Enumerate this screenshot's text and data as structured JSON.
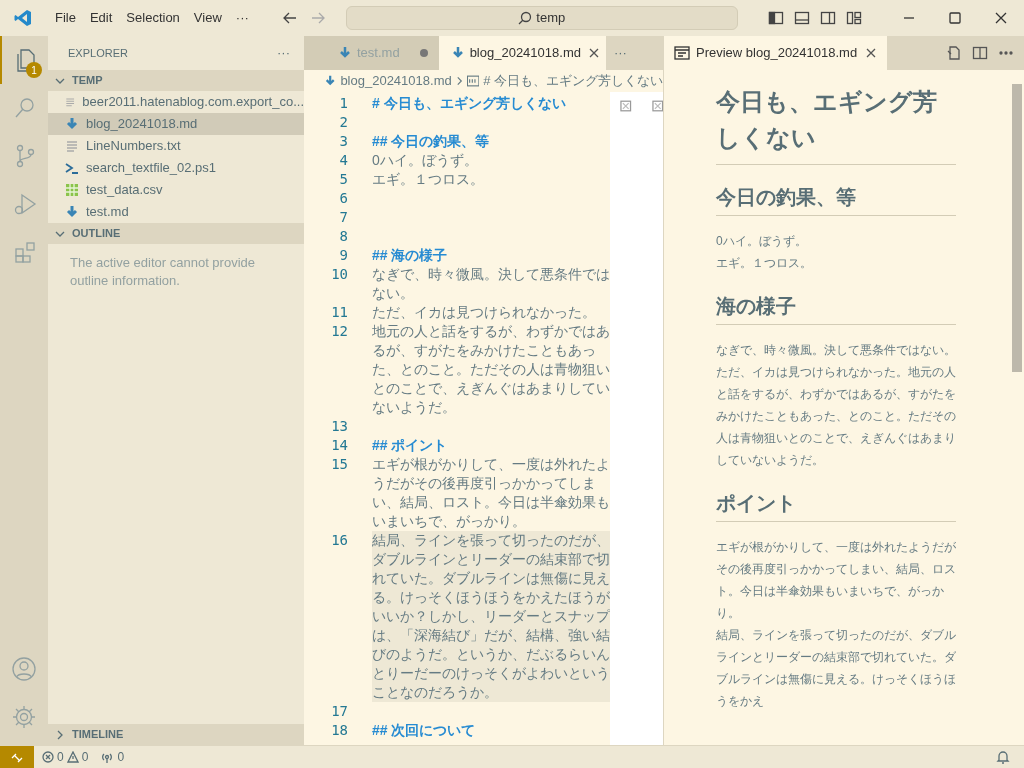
{
  "title_bar": {
    "menu": [
      "File",
      "Edit",
      "Selection",
      "View",
      "···"
    ],
    "search": "temp"
  },
  "activity_bar": {
    "items": [
      {
        "kind": "explorer",
        "selected": true,
        "badge": "1"
      },
      {
        "kind": "search",
        "selected": false
      },
      {
        "kind": "source-control",
        "selected": false
      },
      {
        "kind": "run",
        "selected": false
      },
      {
        "kind": "extensions",
        "selected": false
      }
    ],
    "bottom": [
      {
        "kind": "account"
      },
      {
        "kind": "settings"
      }
    ]
  },
  "sidebar": {
    "title": "EXPLORER",
    "more": "···",
    "sections": [
      {
        "title": "TEMP",
        "expanded": true,
        "files": [
          {
            "name": "beer2011.hatenablog.com.export_co...",
            "kind": "text",
            "selected": false
          },
          {
            "name": "blog_20241018.md",
            "kind": "markdown",
            "selected": true
          },
          {
            "name": "LineNumbers.txt",
            "kind": "text",
            "selected": false
          },
          {
            "name": "search_textfile_02.ps1",
            "kind": "powershell",
            "selected": false
          },
          {
            "name": "test_data.csv",
            "kind": "csv",
            "selected": false
          },
          {
            "name": "test.md",
            "kind": "markdown",
            "selected": false
          }
        ]
      },
      {
        "title": "OUTLINE",
        "expanded": true,
        "message": "The active editor cannot provide outline information."
      },
      {
        "title": "TIMELINE",
        "expanded": false
      }
    ]
  },
  "editor": {
    "tabs": [
      {
        "label": "test.md",
        "selected": false,
        "dirty": true
      },
      {
        "label": "blog_20241018.md",
        "selected": true,
        "dirty": false
      }
    ],
    "more": "···",
    "breadcrumb": [
      "blog_20241018.md",
      "# 今日も、エギング芳しくない"
    ],
    "lines": [
      {
        "number": "1",
        "kind": "heading",
        "text": "# 今日も、エギング芳しくない",
        "current": false
      },
      {
        "number": "2",
        "kind": "blank",
        "current": false
      },
      {
        "number": "3",
        "kind": "heading",
        "text": "## 今日の釣果、等",
        "current": false
      },
      {
        "number": "4",
        "kind": "text",
        "text": "0ハイ。ぼうず。",
        "current": false
      },
      {
        "number": "5",
        "kind": "text",
        "text": "エギ。１つロス。",
        "current": false
      },
      {
        "number": "6",
        "kind": "blank",
        "current": false
      },
      {
        "number": "7",
        "kind": "blank",
        "current": false
      },
      {
        "number": "8",
        "kind": "blank",
        "current": false
      },
      {
        "number": "9",
        "kind": "heading",
        "text": "## 海の様子",
        "current": false
      },
      {
        "number": "10",
        "kind": "text",
        "text": "なぎで、時々微風。決して悪条件ではない。",
        "current": false
      },
      {
        "number": "11",
        "kind": "text",
        "text": "ただ、イカは見つけられなかった。",
        "current": false
      },
      {
        "number": "12",
        "kind": "text",
        "text": "地元の人と話をするが、わずかではあるが、すがたをみかけたこともあった、とのこと。ただその人は青物狙いとのことで、えぎんぐはあまりしていないようだ。",
        "current": false
      },
      {
        "number": "13",
        "kind": "blank",
        "current": false
      },
      {
        "number": "14",
        "kind": "heading",
        "text": "## ポイント",
        "current": false
      },
      {
        "number": "15",
        "kind": "text",
        "text": "エギが根がかりして、一度は外れたようだがその後再度引っかかってしまい、結局、ロスト。今日は半傘効果もいまいちで、がっかり。",
        "current": false
      },
      {
        "number": "16",
        "kind": "text",
        "text": "結局、ラインを張って切ったのだが、ダブルラインとリーダーの結束部で切れていた。ダブルラインは無傷に見える。けっそくほうほうをかえたほうがいいか？しかし、リーダーとスナップは、「深海結び」だが、結構、強い結びのようだ。というか、だぶるらいんとりーだーのけっそくがよわいということなのだろうか。",
        "current": true
      },
      {
        "number": "17",
        "kind": "blank",
        "current": false
      },
      {
        "number": "18",
        "kind": "heading",
        "text": "## 次回について",
        "current": false
      }
    ]
  },
  "preview": {
    "tab": "Preview blog_20241018.md",
    "blocks": [
      {
        "kind": "h1",
        "text": "今日も、エギング芳しくない"
      },
      {
        "kind": "h2",
        "text": "今日の釣果、等"
      },
      {
        "kind": "p",
        "lines": [
          "0ハイ。ぼうず。",
          "エギ。１つロス。"
        ]
      },
      {
        "kind": "h2",
        "text": "海の様子"
      },
      {
        "kind": "p",
        "lines": [
          "なぎで、時々微風。決して悪条件ではない。",
          "ただ、イカは見つけられなかった。地元の人と話をするが、わずかではあるが、すがたをみかけたこともあった、とのこと。ただその人は青物狙いとのことで、えぎんぐはあまりしていないようだ。"
        ]
      },
      {
        "kind": "h2",
        "text": "ポイント"
      },
      {
        "kind": "p",
        "lines": [
          "エギが根がかりして、一度は外れたようだがその後再度引っかかってしまい、結局、ロスト。今日は半傘効果もいまいちで、がっかり。",
          "結局、ラインを張って切ったのだが、ダブルラインとリーダーの結束部で切れていた。ダブルラインは無傷に見える。けっそくほうほうをかえ"
        ]
      }
    ]
  },
  "status_bar": {
    "errors": "0",
    "warnings": "0",
    "ports": "0"
  }
}
